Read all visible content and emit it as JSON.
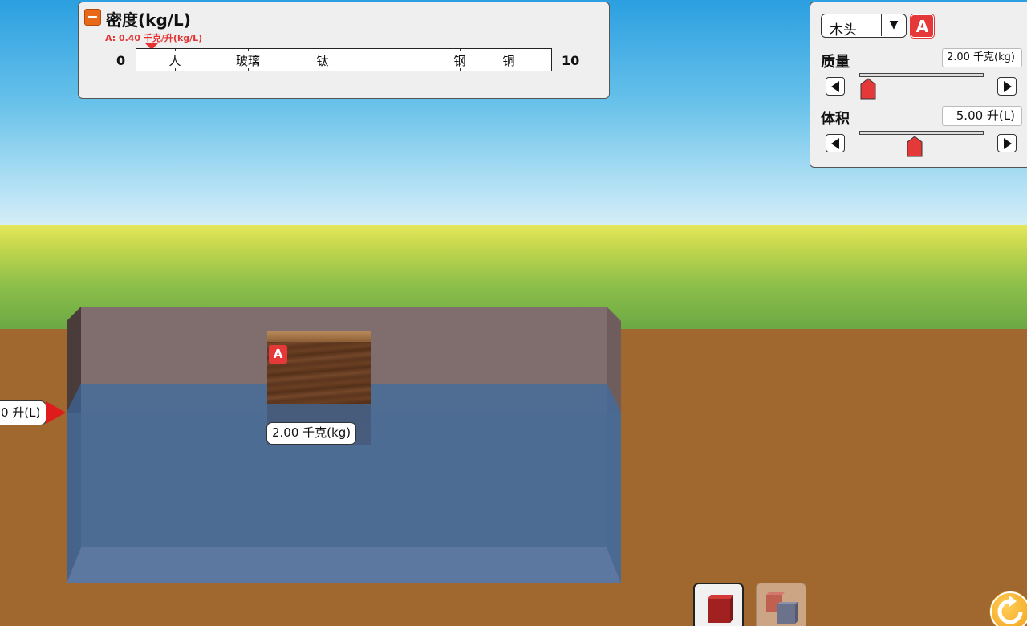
{
  "density_panel": {
    "title": "密度(kg/L)",
    "marker_label": "A: 0.40 千克/升(kg/L)",
    "marker_value": 0.4,
    "scale_min": "0",
    "scale_max": "10",
    "reference_materials": [
      {
        "label": "人",
        "density": 0.95
      },
      {
        "label": "玻璃",
        "density": 2.7
      },
      {
        "label": "钛",
        "density": 4.5
      },
      {
        "label": "钢",
        "density": 7.8
      },
      {
        "label": "铜",
        "density": 8.96
      }
    ]
  },
  "controls": {
    "material": "木头",
    "block_badge": "A",
    "mass_label": "质量",
    "mass_value": "2.00 千克(kg)",
    "mass_fraction": 0.02,
    "volume_label": "体积",
    "volume_value": "5.00 升(L)",
    "volume_fraction": 0.45
  },
  "scene": {
    "block_badge": "A",
    "block_mass_readout": "2.00 千克(kg)",
    "pool_volume_readout": "0 升(L)"
  },
  "icons": {
    "collapse": "minus-icon",
    "dropdown": "chevron-down-icon",
    "decrement": "left-arrow-icon",
    "increment": "right-arrow-icon",
    "single_block_mode": "single-block-icon",
    "compare_blocks_mode": "two-blocks-icon",
    "reset": "reset-icon"
  },
  "colors": {
    "accent_red": "#e53939",
    "collapse_orange": "#e8691a",
    "reset_orange": "#f2a21b"
  }
}
